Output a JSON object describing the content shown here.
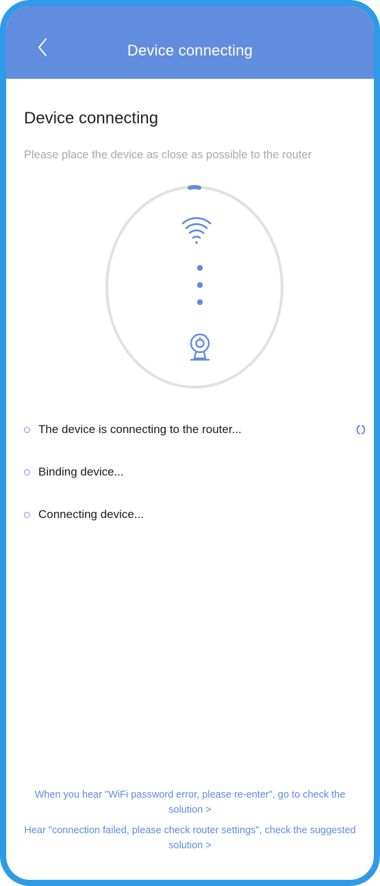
{
  "colors": {
    "header_bg": "#628dde",
    "accent": "#5f8ae0",
    "frame_border": "#2f9ae8"
  },
  "header": {
    "title": "Device connecting",
    "back_icon": "chevron-left-icon"
  },
  "main": {
    "title": "Device connecting",
    "subtitle": "Please place the device as close as possible to the router"
  },
  "illustration": {
    "top_icon": "wifi-icon",
    "bottom_icon": "camera-icon"
  },
  "statuses": [
    {
      "label": "The device is connecting to the router...",
      "state": "in-progress"
    },
    {
      "label": "Binding device...",
      "state": "pending"
    },
    {
      "label": "Connecting device...",
      "state": "pending"
    }
  ],
  "help_links": [
    {
      "text": "When you hear \"WiFi password error, please re-enter\", go to check the solution >"
    },
    {
      "text": "Hear \"connection failed, please check router settings\", check the suggested solution >"
    }
  ]
}
